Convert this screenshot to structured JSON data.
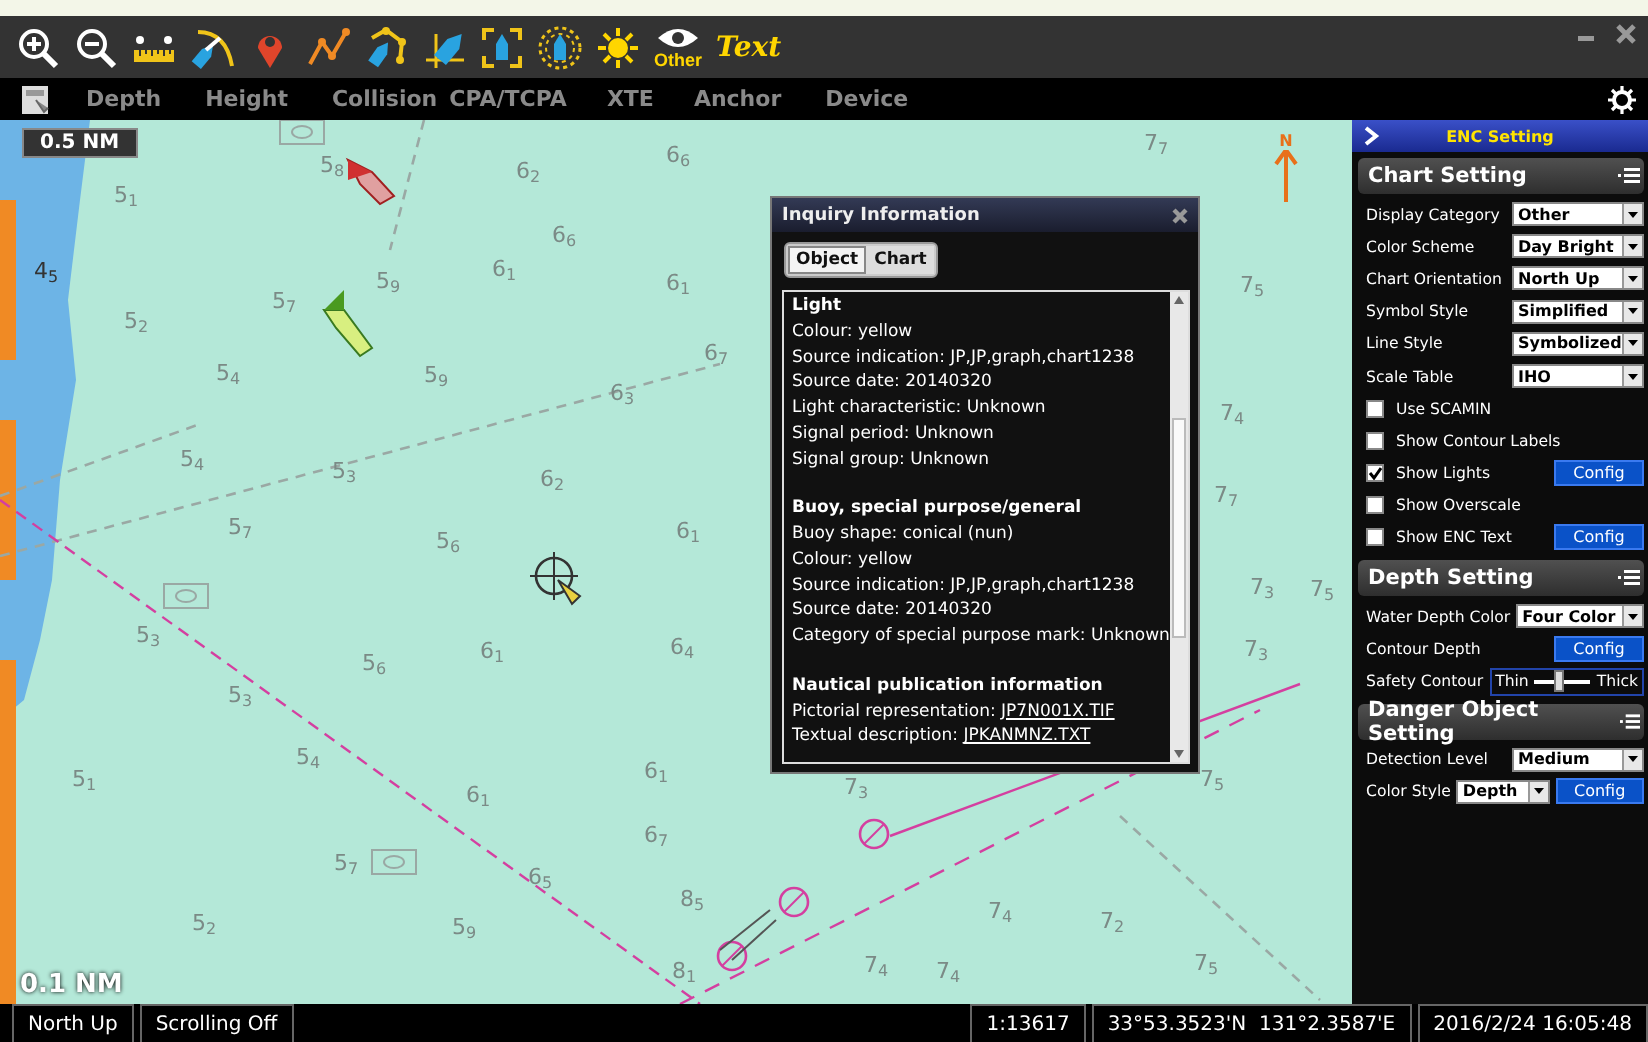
{
  "toolbar": {
    "tools": [
      {
        "kind": "zoom-in"
      },
      {
        "kind": "zoom-out"
      },
      {
        "kind": "ruler"
      },
      {
        "kind": "range"
      },
      {
        "kind": "pin"
      },
      {
        "kind": "route"
      },
      {
        "kind": "ship-route"
      },
      {
        "kind": "north-ship"
      },
      {
        "kind": "frame-ship"
      },
      {
        "kind": "ring-ship"
      },
      {
        "kind": "sun"
      },
      {
        "kind": "eye",
        "label": "Other"
      },
      {
        "kind": "text",
        "label": "Text"
      }
    ]
  },
  "nav": {
    "items": [
      "Depth",
      "Height",
      "Collision",
      "CPA/TCPA",
      "XTE",
      "Anchor",
      "Device"
    ]
  },
  "map": {
    "scale_top": "0.5 NM",
    "scale_bottom": "0.1 NM",
    "north_label": "N",
    "soundings": [
      "5$_{1}$",
      "5$_{8}$",
      "6$_{2}$",
      "6$_{6}$",
      "7$_{7}$",
      "4$_{5}$",
      "5$_{2}$",
      "5$_{7}$",
      "5$_{9}$",
      "6$_{1}$",
      "6$_{6}$",
      "6$_{1}$",
      "5$_{4}$",
      "6$_{3}$",
      "6$_{7}$",
      "5$_{9}$",
      "5$_{4}$",
      "5$_{3}$",
      "6$_{2}$",
      "5$_{6}$",
      "5$_{7}$",
      "6$_{1}$",
      "5$_{3}$",
      "5$_{6}$",
      "6$_{1}$",
      "6$_{4}$",
      "5$_{3}$",
      "5$_{1}$",
      "5$_{4}$",
      "6$_{1}$",
      "6$_{1}$",
      "7$_{3}$",
      "5$_{7}$",
      "6$_{5}$",
      "6$_{7}$",
      "8$_{5}$",
      "5$_{2}$",
      "5$_{9}$",
      "7$_{4}$",
      "7$_{2}$",
      "8$_{1}$",
      "7$_{4}$",
      "7$_{4}$",
      "7$_{5}$",
      "7$_{4}$",
      "7$_{7}$",
      "7$_{3}$",
      "7$_{3}$",
      "7$_{5}$",
      "7$_{5}$",
      "7$_{5}$"
    ]
  },
  "inquiry": {
    "title": "Inquiry Information",
    "tabs": [
      {
        "label": "Object",
        "selected": true
      },
      {
        "label": "Chart",
        "selected": false
      }
    ],
    "sections": [
      {
        "heading": "Light",
        "lines": [
          {
            "text": "Colour: yellow"
          },
          {
            "text": "Source indication: JP,JP,graph,chart1238"
          },
          {
            "text": "Source date: 20140320"
          },
          {
            "text": "Light characteristic: Unknown"
          },
          {
            "text": "Signal period: Unknown"
          },
          {
            "text": "Signal group: Unknown"
          }
        ]
      },
      {
        "heading": "Buoy, special purpose/general",
        "lines": [
          {
            "text": "Buoy shape: conical (nun)"
          },
          {
            "text": "Colour: yellow"
          },
          {
            "text": "Source indication: JP,JP,graph,chart1238"
          },
          {
            "text": "Source date: 20140320"
          },
          {
            "text": "Category of special purpose mark: Unknown"
          }
        ]
      },
      {
        "heading": "Nautical publication information",
        "lines": [
          {
            "text": "Pictorial representation:",
            "link": "JP7N001X.TIF"
          },
          {
            "text": "Textual description:",
            "link": "JPKANMNZ.TXT"
          }
        ]
      }
    ]
  },
  "settings": {
    "title": "ENC Setting",
    "groups": [
      {
        "title": "Chart Setting",
        "rows": [
          {
            "kind": "select",
            "label": "Display Category",
            "value": "Other"
          },
          {
            "kind": "select",
            "label": "Color Scheme",
            "value": "Day Bright"
          },
          {
            "kind": "select",
            "label": "Chart Orientation",
            "value": "North Up"
          },
          {
            "kind": "select",
            "label": "Symbol Style",
            "value": "Simplified"
          },
          {
            "kind": "select",
            "label": "Line Style",
            "value": "Symbolized"
          },
          {
            "kind": "select",
            "label": "Scale Table",
            "value": "IHO"
          },
          {
            "kind": "checkbox",
            "label": "Use SCAMIN",
            "checked": false
          },
          {
            "kind": "checkbox",
            "label": "Show Contour Labels",
            "checked": false
          },
          {
            "kind": "checkbox",
            "label": "Show Lights",
            "checked": true,
            "button": "Config"
          },
          {
            "kind": "checkbox",
            "label": "Show Overscale",
            "checked": false
          },
          {
            "kind": "checkbox",
            "label": "Show ENC Text",
            "checked": false,
            "button": "Config"
          }
        ]
      },
      {
        "title": "Depth Setting",
        "rows": [
          {
            "kind": "select",
            "label": "Water Depth Color",
            "value": "Four Color"
          },
          {
            "kind": "button",
            "label": "Contour Depth",
            "button": "Config"
          },
          {
            "kind": "slider",
            "label": "Safety Contour",
            "min_label": "Thin",
            "max_label": "Thick",
            "level": 0.4
          }
        ]
      },
      {
        "title": "Danger Object Setting",
        "rows": [
          {
            "kind": "select",
            "label": "Detection Level",
            "value": "Medium"
          },
          {
            "kind": "select-button",
            "label": "Color Style",
            "value": "Depth",
            "button": "Config"
          }
        ]
      }
    ]
  },
  "status_bar": {
    "left": [
      "North Up",
      "Scrolling Off"
    ],
    "right": [
      "1:13617",
      "33°53.3523'N  131°2.3587'E",
      "2016/2/24 16:05:48"
    ]
  }
}
